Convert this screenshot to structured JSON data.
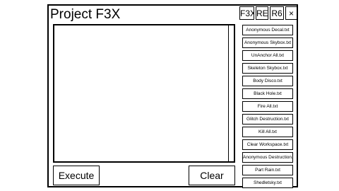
{
  "window": {
    "title": "Project F3X",
    "header_buttons": [
      "F3X",
      "RE",
      "R6",
      "×"
    ]
  },
  "editor": {
    "value": ""
  },
  "actions": {
    "execute_label": "Execute",
    "clear_label": "Clear"
  },
  "scripts": [
    "Anonymous Decal.txt",
    "Anonymous Skybox.txt",
    "UnAnchor All.txt",
    "Skeleton Skybox.txt",
    "Body Disco.txt",
    "Black Hole.txt",
    "Fire All.txt",
    "Glitch Destruction.txt",
    "Kill All.txt",
    "Clear Workspace.txt",
    "Anonymous Destruction.txt",
    "Part Rain.txt",
    "Shedletsky.txt"
  ]
}
